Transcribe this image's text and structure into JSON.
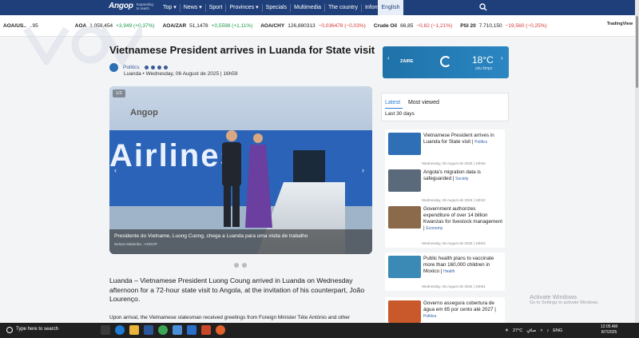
{
  "nav": {
    "logo": "Angop",
    "tagline": "Expanding to reach",
    "menu": [
      "Top ▾",
      "News ▾",
      "Sport",
      "Provinces ▾",
      "Specials",
      "Multimedia",
      "The country",
      "Information"
    ],
    "language": "English"
  },
  "ticker": [
    {
      "sym": "AOA/US..",
      "val": "..95",
      "chg": "",
      "dir": "up"
    },
    {
      "sym": "AOA",
      "val": "1.059,454",
      "chg": "+3,949 (+0,37%)",
      "dir": "up"
    },
    {
      "sym": "AOA/ZAR",
      "val": "51,1478",
      "chg": "+0,5598 (+1,11%)",
      "dir": "up"
    },
    {
      "sym": "AOA/CHY",
      "val": "126,880313",
      "chg": "−0,036478 (−0,03%)",
      "dir": "dn"
    },
    {
      "sym": "Crude Oil",
      "val": "66,85",
      "chg": "−0,82 (−1,21%)",
      "dir": "dn"
    },
    {
      "sym": "PSI 20",
      "val": "7.710,150",
      "chg": "−19,560 (−0,25%)",
      "dir": "dn"
    }
  ],
  "tradingview": "TradingView",
  "article": {
    "title": "Vietnamese President arrives in Luanda for State visit",
    "category": "Politics",
    "dateline": "Luanda • Wednesday, 06 August de 2025 | 16h59",
    "photo_counter": "1/2",
    "photo_watermark": "Angop",
    "photo_brand": "Airlines",
    "caption": "Presidente do Vietname, Luong Cuong, chega a Luanda para uma visita de trabalho",
    "photo_credit": "Nelson Malamba - ANGOP",
    "lead": "Luanda – Vietnamese President Luong Coung arrived in Luanda on Wednesday afternoon for a 72-hour state visit to Angola, at the invitation of his counterpart, João Lourenço.",
    "body_first_line": "Upon arrival, the Vietnamese statesman received greetings from Foreign Minister Téte António and other"
  },
  "weather": {
    "city": "ZAIRE",
    "temp": "18°C",
    "condition": "céu limpo",
    "prev": "‹",
    "next": "›"
  },
  "sidebar": {
    "tab_latest": "Latest",
    "tab_most_viewed": "Most viewed",
    "period": "Last 30 days",
    "items": [
      {
        "headline": "Vietnamese President arrives in Luanda for State visit |",
        "category": "Politics",
        "date": "Wednesday, 06 August de 2025 | 16h59",
        "color": "#2f6fb5"
      },
      {
        "headline": "Angola's migration data is safeguarded |",
        "category": "Society",
        "date": "Wednesday, 06 August de 2025 | 16h32",
        "color": "#5a6a7a"
      },
      {
        "headline": "Government authorizes expenditure of over 14 billion Kwanzas for livestock management |",
        "category": "Economy",
        "date": "Wednesday, 06 August de 2025 | 16h03",
        "color": "#8a6a4a"
      },
      {
        "headline": "Public health plans to vaccinate more than 160,000 children in Moxico |",
        "category": "Health",
        "date": "Wednesday, 06 August de 2025 | 15h54",
        "color": "#3a8ab5"
      },
      {
        "headline": "Governo assegura cobertura de água em 65 por cento até 2027 |",
        "category": "Politica",
        "date": "",
        "color": "#c9582a"
      }
    ]
  },
  "activate": {
    "line1": "Activate Windows",
    "line2": "Go to Settings to activate Windows."
  },
  "taskbar": {
    "search_placeholder": "Type here to search",
    "temp": "27°C",
    "weather_label": "صافٍ",
    "lang": "ENG",
    "time": "12:05 AM",
    "date": "8/7/2025"
  }
}
